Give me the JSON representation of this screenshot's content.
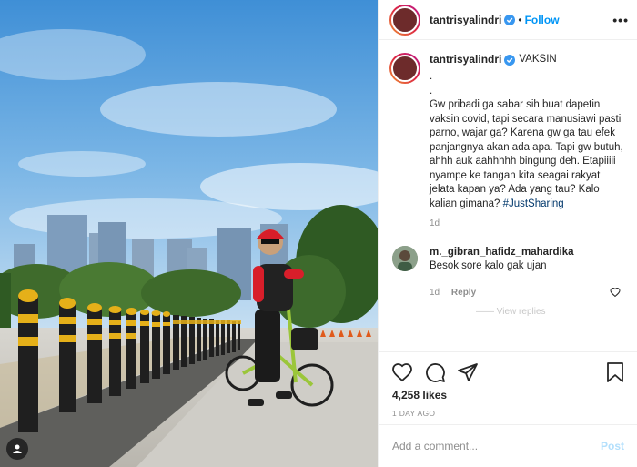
{
  "header": {
    "username": "tantrisyalindri",
    "separator": "•",
    "follow_label": "Follow",
    "more_label": "•••"
  },
  "caption": {
    "username": "tantrisyalindri",
    "location": "VAKSIN",
    "text": ".\n.\nGw pribadi ga sabar sih buat dapetin vaksin covid, tapi secara manusiawi pasti parno, wajar ga? Karena gw ga tau efek panjangnya akan ada apa. Tapi gw butuh, ahhh auk aahhhhh bingung deh. Etapiiiii nyampe ke tangan kita seagai rakyat jelata kapan ya? Ada yang tau? Kalo kalian gimana? ",
    "hashtag": "#JustSharing",
    "time": "1d"
  },
  "comment": {
    "username": "m._gibran_hafidz_mahardika",
    "text": "Besok sore kalo gak ujan",
    "time": "1d",
    "reply_label": "Reply",
    "next_hint": "—— View replies"
  },
  "actions": {
    "like_icon": "heart-icon",
    "comment_icon": "comment-icon",
    "share_icon": "share-icon",
    "save_icon": "bookmark-icon"
  },
  "likes": "4,258 likes",
  "date": "1 DAY AGO",
  "add_comment": {
    "placeholder": "Add a comment...",
    "post_label": "Post"
  },
  "colors": {
    "accent": "#0095f6",
    "hashtag": "#00376b",
    "muted": "#8e8e8e",
    "post_disabled": "#b2dffc"
  }
}
